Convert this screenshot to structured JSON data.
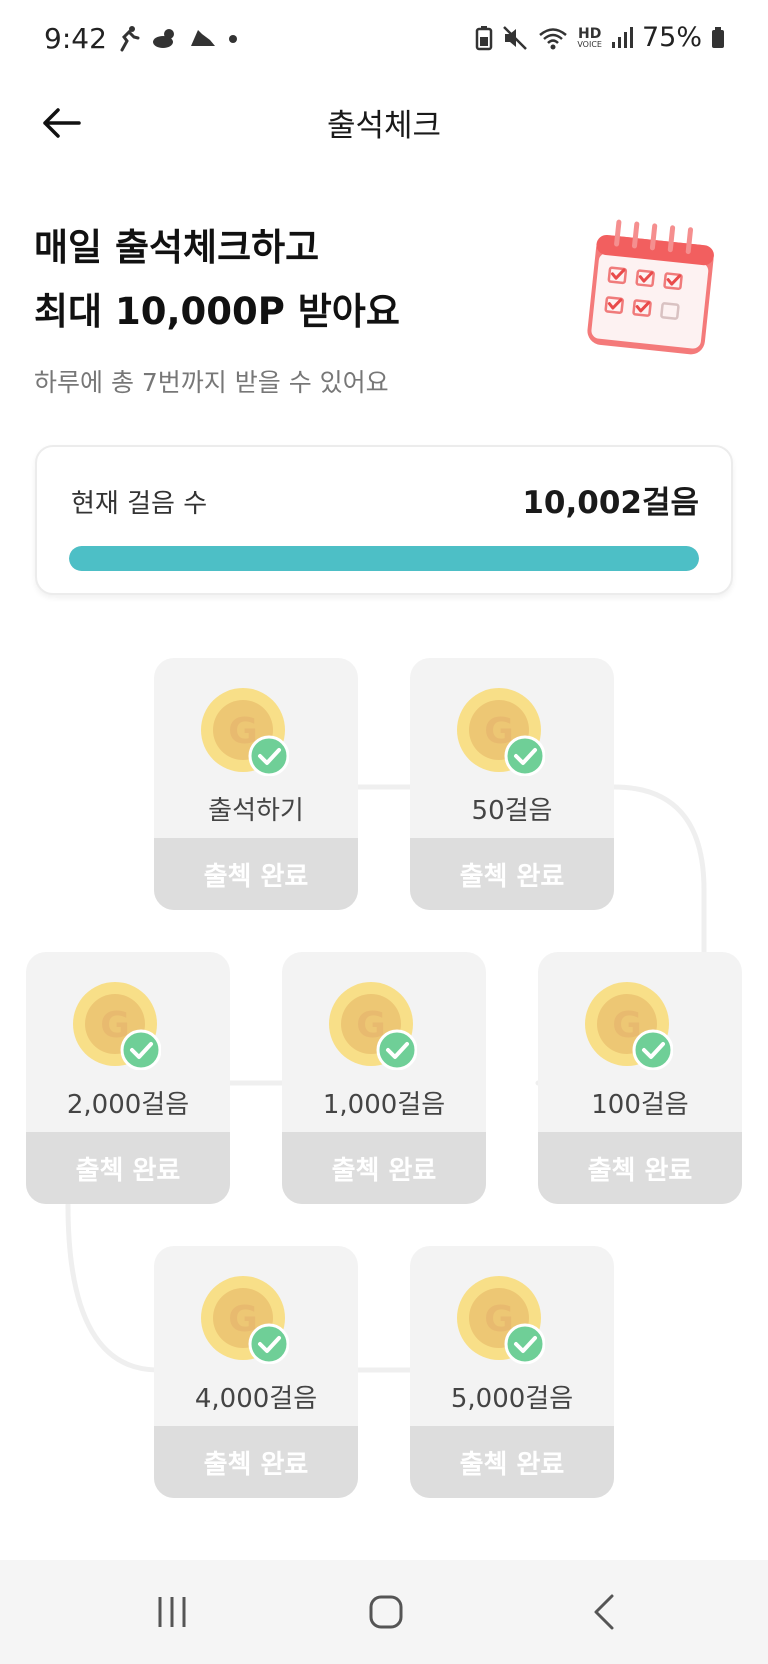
{
  "status_bar": {
    "time": "9:42",
    "battery": "75%",
    "left_icons": [
      "runner-icon",
      "cloud-sun-icon",
      "running-shoe-icon",
      "dot-icon"
    ],
    "right_icons": [
      "battery-saver-icon",
      "mute-icon",
      "wifi-icon",
      "hd-voice-icon",
      "signal-icon",
      "battery-icon"
    ],
    "hd_label": "HD",
    "voice_label": "VOICE"
  },
  "header": {
    "title": "출석체크",
    "back_icon": "arrow-left-icon"
  },
  "hero": {
    "title_line1": "매일 출석체크하고",
    "title_line2": "최대 10,000P 받아요",
    "subtitle": "하루에 총 7번까지 받을 수 있어요",
    "illustration": "calendar-checklist-icon"
  },
  "steps": {
    "label": "현재 걸음 수",
    "value": "10,002걸음",
    "progress": 1.0
  },
  "colors": {
    "accent": "#4dbfc6",
    "coin_outer": "#f8df88",
    "coin_inner": "#edc774",
    "coin_letter": "#e8ba6f",
    "check_badge": "#6fcf97",
    "tile_bg": "#f3f3f3",
    "tile_footer": "#dddddd"
  },
  "tiles": [
    {
      "label": "출석하기",
      "button": "출첵 완료",
      "coin_letter": "G"
    },
    {
      "label": "50걸음",
      "button": "출첵 완료",
      "coin_letter": "G"
    },
    {
      "label": "100걸음",
      "button": "출첵 완료",
      "coin_letter": "G"
    },
    {
      "label": "1,000걸음",
      "button": "출첵 완료",
      "coin_letter": "G"
    },
    {
      "label": "2,000걸음",
      "button": "출첵 완료",
      "coin_letter": "G"
    },
    {
      "label": "4,000걸음",
      "button": "출첵 완료",
      "coin_letter": "G"
    },
    {
      "label": "5,000걸음",
      "button": "출첵 완료",
      "coin_letter": "G"
    }
  ],
  "nav_bar": {
    "icons": [
      "recent-apps-icon",
      "home-icon",
      "back-nav-icon"
    ]
  }
}
